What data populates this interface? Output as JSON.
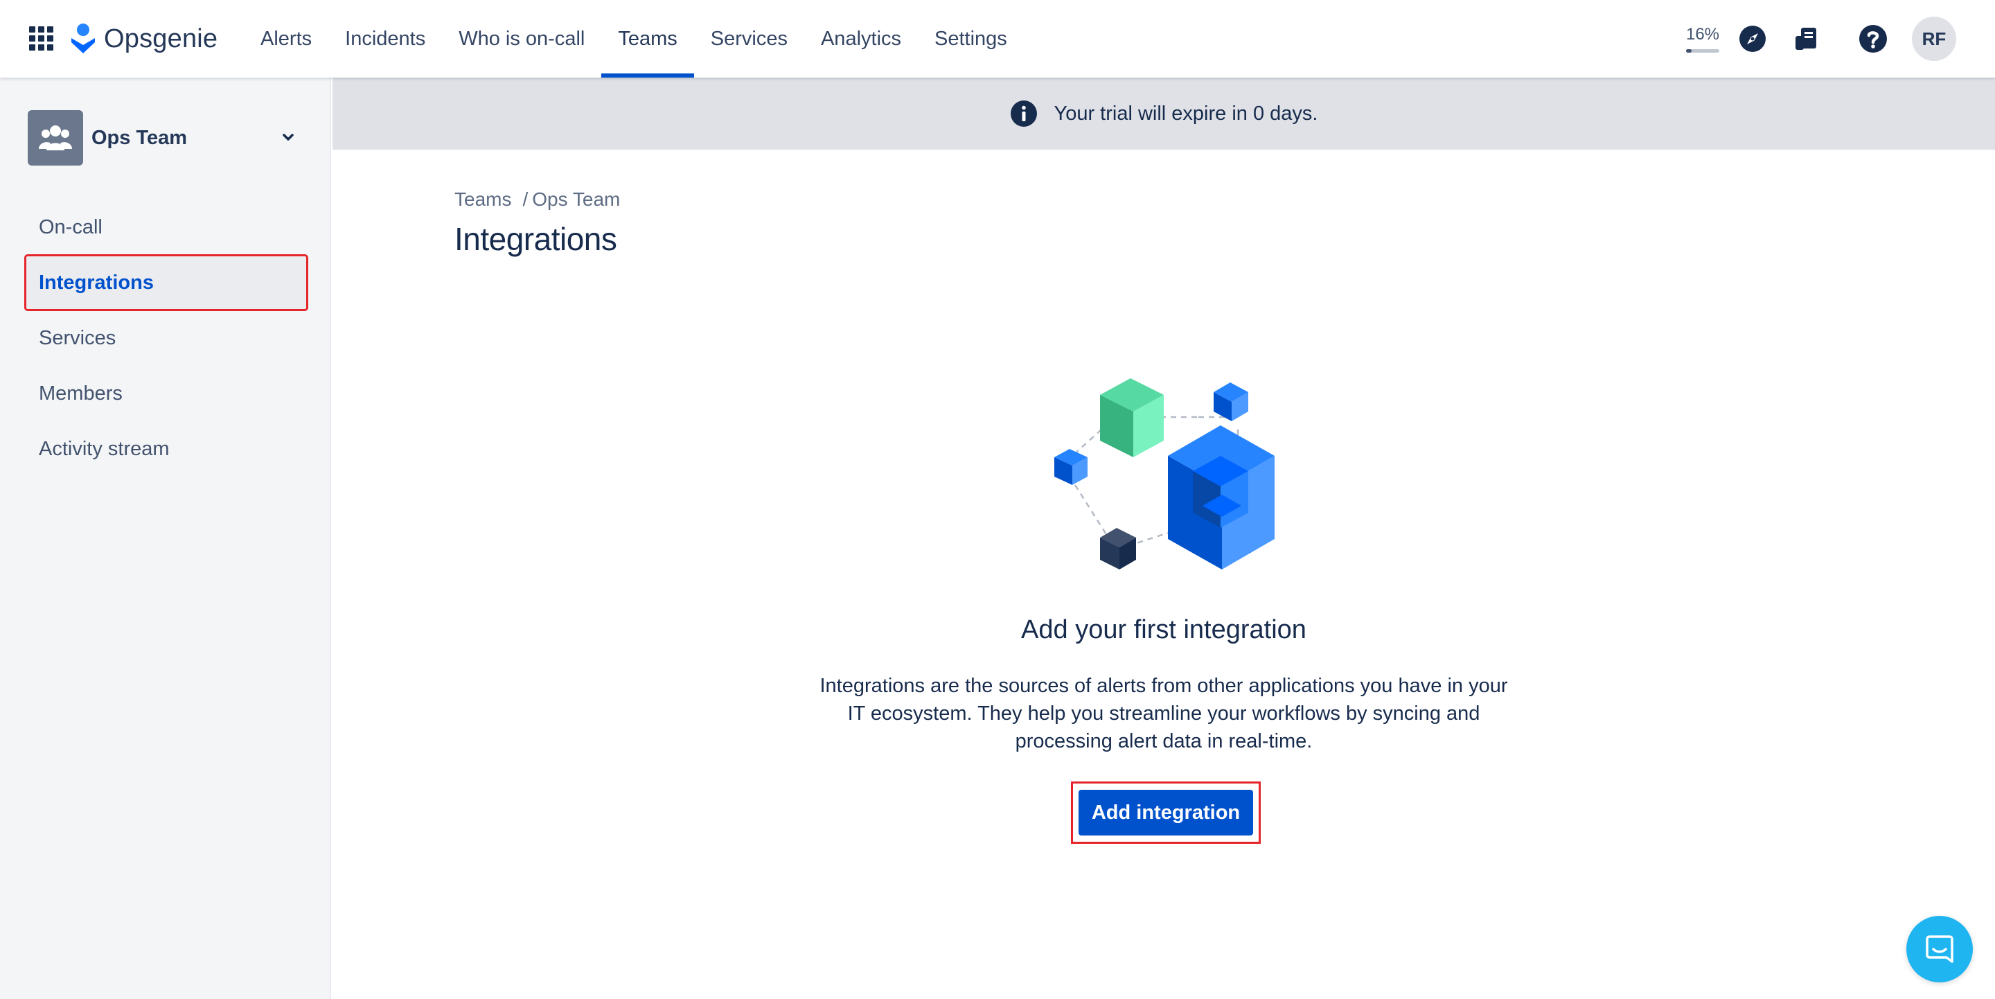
{
  "app": {
    "logo_text": "Opsgenie",
    "nav": [
      {
        "label": "Alerts"
      },
      {
        "label": "Incidents"
      },
      {
        "label": "Who is on-call"
      },
      {
        "label": "Teams",
        "active": true
      },
      {
        "label": "Services"
      },
      {
        "label": "Analytics"
      },
      {
        "label": "Settings"
      }
    ],
    "trial_progress": {
      "label": "16%",
      "fraction": 0.16
    },
    "icons": {
      "app_switcher": "grid-icon",
      "compass": "compass-icon",
      "whats_new": "feedback-icon",
      "help": "help-icon"
    },
    "avatar_initials": "RF"
  },
  "sidebar": {
    "team_name": "Ops Team",
    "items": [
      {
        "label": "On-call"
      },
      {
        "label": "Integrations",
        "active": true
      },
      {
        "label": "Services"
      },
      {
        "label": "Members"
      },
      {
        "label": "Activity stream"
      }
    ]
  },
  "banner": {
    "message": "Your trial will expire in 0 days."
  },
  "breadcrumb": {
    "root": "Teams",
    "separator": "/",
    "current": "Ops Team"
  },
  "page": {
    "title": "Integrations"
  },
  "empty_state": {
    "title": "Add your first integration",
    "description": "Integrations are the sources of alerts from other applications you have in your IT ecosystem. They help you streamline your workflows by syncing and processing alert data in real-time.",
    "button_label": "Add integration"
  },
  "colors": {
    "primary": "#0052CC",
    "highlight_outline": "#E5252A",
    "chat": "#1FB5F0"
  }
}
